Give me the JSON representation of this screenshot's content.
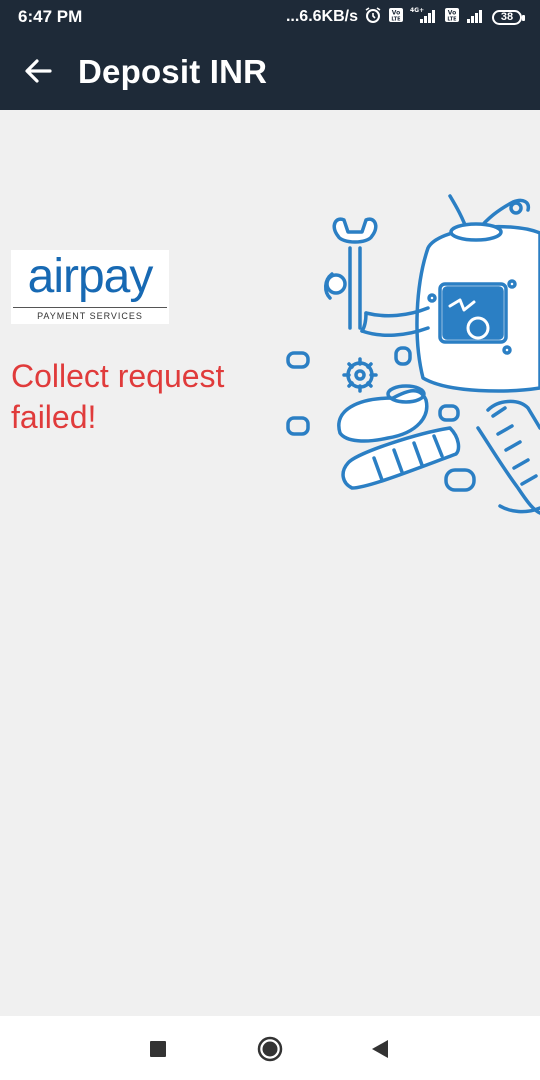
{
  "status_bar": {
    "time": "6:47 PM",
    "net_speed": "...6.6KB/s",
    "battery": "38",
    "icons": [
      "alarm-icon",
      "volte-icon",
      "signal-4g-icon",
      "volte-icon",
      "signal-icon",
      "battery-icon"
    ]
  },
  "app_bar": {
    "title": "Deposit INR",
    "back_icon": "arrow-back-icon"
  },
  "content": {
    "logo_text": "airpay",
    "logo_tagline": "PAYMENT SERVICES",
    "error_message": "Collect request failed!",
    "illustration": "broken-robot-illustration"
  },
  "nav_bar": {
    "buttons": [
      "recents-square-icon",
      "home-circle-icon",
      "back-triangle-icon"
    ]
  },
  "colors": {
    "bar_bg": "#1e2a38",
    "page_bg": "#f0f0f0",
    "error": "#e03b3b",
    "brand_blue": "#1769b3",
    "illustration_blue": "#2b7fc4"
  }
}
